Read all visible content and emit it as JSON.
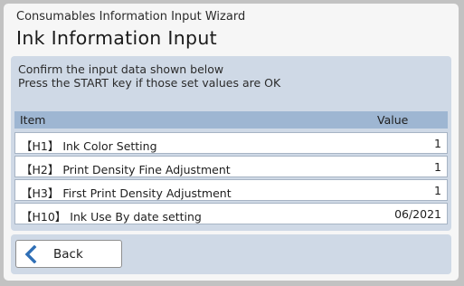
{
  "header": {
    "wizard_title": "Consumables Information Input Wizard",
    "page_title": "Ink Information Input"
  },
  "instructions": {
    "line1": "Confirm the input data shown below",
    "line2": "Press the START key if those set values are OK"
  },
  "table": {
    "columns": {
      "item": "Item",
      "value": "Value"
    },
    "rows": [
      {
        "item": "【H1】 Ink Color Setting",
        "value": "1"
      },
      {
        "item": "【H2】 Print Density Fine Adjustment",
        "value": "1"
      },
      {
        "item": "【H3】 First Print Density Adjustment",
        "value": "1"
      },
      {
        "item": "【H10】 Ink Use By date setting",
        "value": "06/2021"
      }
    ]
  },
  "footer": {
    "back_label": "Back",
    "back_icon": "chevron-left-icon"
  },
  "colors": {
    "panel": "#cfd9e6",
    "table_header": "#9eb6d2",
    "back_chevron": "#2f6fb6",
    "bezel": "#c2c2c2"
  }
}
